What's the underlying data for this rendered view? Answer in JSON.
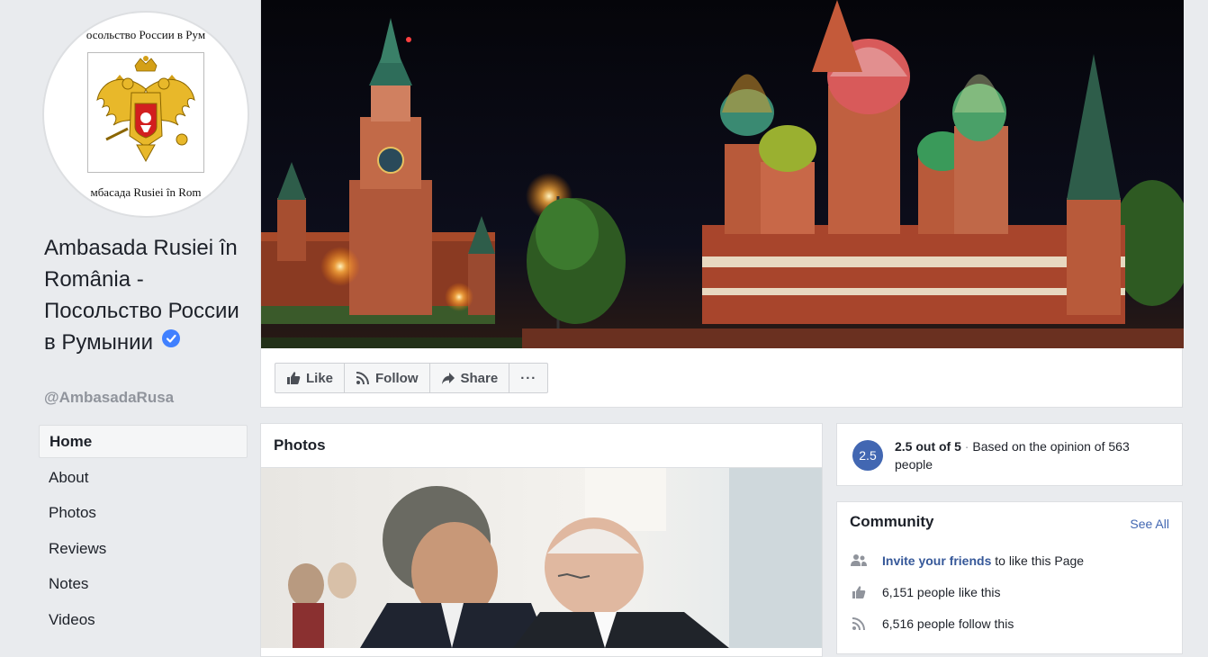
{
  "profile": {
    "seal_top": "осольство России в Рум",
    "seal_bottom": "мбасада Rusiei în Rom",
    "name": "Ambasada Rusiei în România - Посольство России в Румынии",
    "handle": "@AmbasadaRusa"
  },
  "nav": {
    "items": [
      {
        "label": "Home"
      },
      {
        "label": "About"
      },
      {
        "label": "Photos"
      },
      {
        "label": "Reviews"
      },
      {
        "label": "Notes"
      },
      {
        "label": "Videos"
      }
    ]
  },
  "actions": {
    "like": "Like",
    "follow": "Follow",
    "share": "Share",
    "more": "···"
  },
  "photos": {
    "title": "Photos"
  },
  "rating": {
    "score": "2.5",
    "score_label": "2.5 out of 5",
    "separator": " · ",
    "basis": "Based on the opinion of 563 people"
  },
  "community": {
    "title": "Community",
    "see_all": "See All",
    "invite_link": "Invite your friends",
    "invite_rest": " to like this Page",
    "likes": "6,151 people like this",
    "follows": "6,516 people follow this"
  },
  "colors": {
    "accent": "#4267b2",
    "link": "#365899",
    "background": "#e9ebee",
    "verified": "#4080ff"
  }
}
